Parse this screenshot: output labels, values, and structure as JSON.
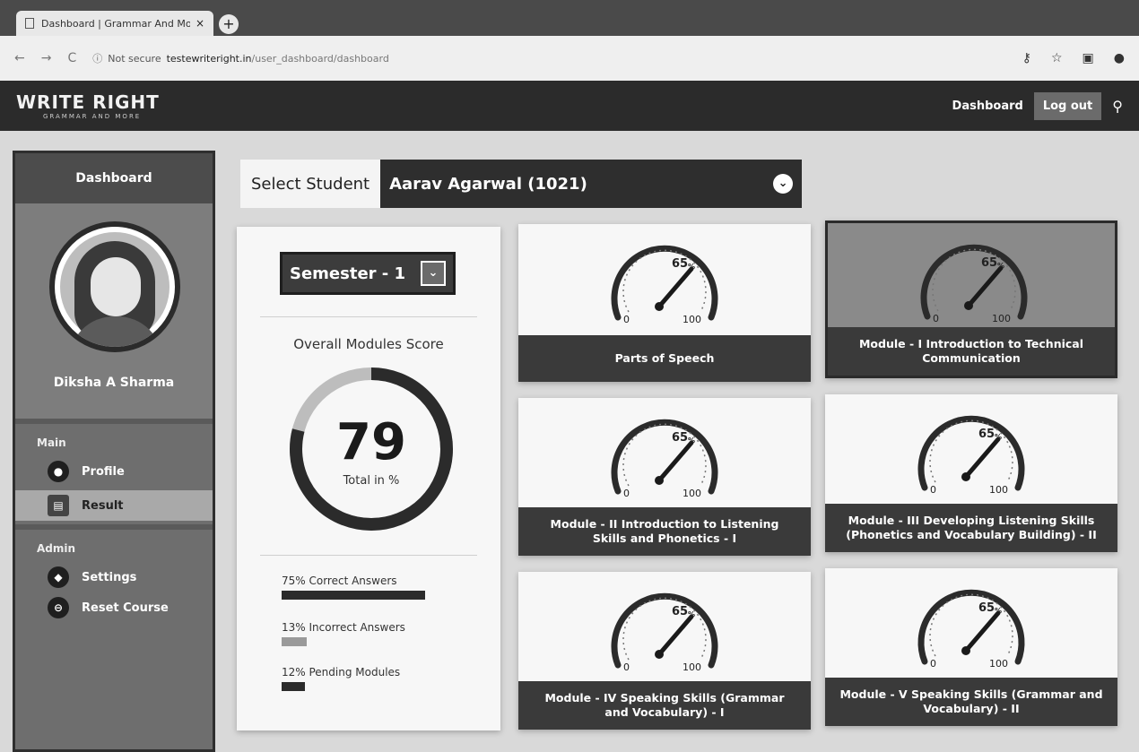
{
  "browser": {
    "tab_title": "Dashboard | Grammar And Mo",
    "tab_close": "×",
    "new_tab": "+",
    "url_notsecure": "Not secure",
    "url_host": "testewriteright.in",
    "url_path": "/user_dashboard/dashboard"
  },
  "header": {
    "logo_main": "WRITE RIGHT",
    "logo_sub": "GRAMMAR AND MORE",
    "dashboard_link": "Dashboard",
    "logout_button": "Log out"
  },
  "sidebar": {
    "title": "Dashboard",
    "user_name": "Diksha A Sharma",
    "main_heading": "Main",
    "items_main": [
      {
        "label": "Profile"
      },
      {
        "label": "Result"
      }
    ],
    "admin_heading": "Admin",
    "items_admin": [
      {
        "label": "Settings"
      },
      {
        "label": "Reset Course"
      }
    ]
  },
  "student_selector": {
    "label": "Select Student",
    "value": "Aarav Agarwal (1021)"
  },
  "overall": {
    "semester": "Semester - 1",
    "title": "Overall Modules Score",
    "score": "79",
    "score_caption": "Total in %",
    "score_value": 79,
    "stats": [
      {
        "label": "75% Correct Answers",
        "value": 75,
        "color": "#2b2b2b"
      },
      {
        "label": "13% Incorrect Answers",
        "value": 13,
        "color": "#9a9a9a"
      },
      {
        "label": "12% Pending Modules",
        "value": 12,
        "color": "#2b2b2b"
      }
    ]
  },
  "modules": [
    {
      "title": "Parts of Speech",
      "gauge_value": "65",
      "gauge_unit": "%",
      "min": "0",
      "max": "100",
      "dark": false
    },
    {
      "title": "Module - I Introduction to Technical Communication",
      "gauge_value": "65",
      "gauge_unit": "%",
      "min": "0",
      "max": "100",
      "dark": true
    },
    {
      "title": "Module - II Introduction to Listening Skills and Phonetics - I",
      "gauge_value": "65",
      "gauge_unit": "%",
      "min": "0",
      "max": "100",
      "dark": false
    },
    {
      "title": "Module - III Developing Listening Skills (Phonetics and Vocabulary Building) - II",
      "gauge_value": "65",
      "gauge_unit": "%",
      "min": "0",
      "max": "100",
      "dark": false
    },
    {
      "title": "Module - IV Speaking Skills (Grammar and Vocabulary) - I",
      "gauge_value": "65",
      "gauge_unit": "%",
      "min": "0",
      "max": "100",
      "dark": false
    },
    {
      "title": "Module - V Speaking Skills (Grammar and Vocabulary) - II",
      "gauge_value": "65",
      "gauge_unit": "%",
      "min": "0",
      "max": "100",
      "dark": false
    }
  ]
}
